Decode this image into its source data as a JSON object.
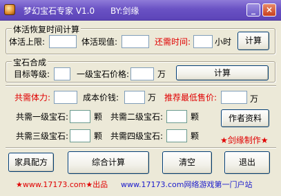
{
  "window": {
    "title": "梦幻宝石专家 V1.0      BY:剑缘"
  },
  "group1": {
    "title": "体活恢复时间计算",
    "vitality_max_label": "体活上限:",
    "vitality_current_label": "体活现值:",
    "time_needed_label": "还需时间:",
    "hours_unit": "小时",
    "calc_button": "计算",
    "vitality_max_value": "",
    "vitality_current_value": "",
    "time_needed_value": ""
  },
  "group2": {
    "title": "宝石合成",
    "target_level_label": "目标等级:",
    "gem_price_label": "一级宝石价格:",
    "wan_unit": "万",
    "calc_button": "计算",
    "target_level_value": "",
    "gem_price_value": ""
  },
  "results": {
    "total_stamina_label": "共需体力:",
    "cost_label": "成本价钱:",
    "cost_unit": "万",
    "min_price_label": "推荐最低售价:",
    "min_price_unit": "万",
    "need_l1_label": "共需一级宝石:",
    "need_l2_label": "共需二级宝石:",
    "need_l3_label": "共需三级宝石:",
    "need_l4_label": "共需四级宝石:",
    "unit_ke": "颗",
    "author_button": "作者资料",
    "signature": "★剑缘制作★"
  },
  "bottom_buttons": {
    "furniture": "家具配方",
    "combined": "综合计算",
    "clear": "清空",
    "exit": "退出"
  },
  "footer": {
    "left": "★www.17173.com★出品",
    "right": "www.17173.com网络游戏第一门户站"
  }
}
